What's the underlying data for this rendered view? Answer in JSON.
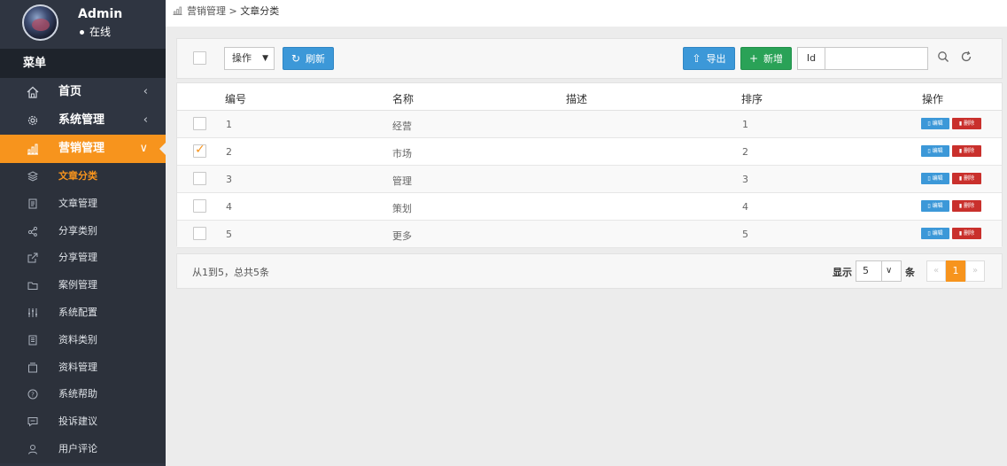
{
  "user": {
    "name": "Admin",
    "status": "在线"
  },
  "menu_header": "菜单",
  "nav": [
    {
      "label": "首页",
      "chevron": "‹"
    },
    {
      "label": "系统管理",
      "chevron": "‹"
    },
    {
      "label": "营销管理",
      "chevron": "∨"
    }
  ],
  "sub_nav": [
    {
      "label": "文章分类"
    },
    {
      "label": "文章管理"
    },
    {
      "label": "分享类别"
    },
    {
      "label": "分享管理"
    },
    {
      "label": "案例管理"
    },
    {
      "label": "系统配置"
    },
    {
      "label": "资料类别"
    },
    {
      "label": "资料管理"
    },
    {
      "label": "系统帮助"
    },
    {
      "label": "投诉建议"
    },
    {
      "label": "用户评论"
    }
  ],
  "breadcrumb": {
    "parent": "营销管理",
    "separator": ">",
    "current": "文章分类"
  },
  "toolbar": {
    "action_select": "操作",
    "refresh": "刷新",
    "export": "导出",
    "add": "新增",
    "search_label": "Id",
    "search_value": ""
  },
  "table": {
    "headers": {
      "id": "编号",
      "name": "名称",
      "desc": "描述",
      "sort": "排序",
      "ops": "操作"
    },
    "edit_label": "编辑",
    "delete_label": "删除",
    "rows": [
      {
        "id": "1",
        "name": "经营",
        "desc": "",
        "sort": "1",
        "checked": false
      },
      {
        "id": "2",
        "name": "市场",
        "desc": "",
        "sort": "2",
        "checked": true
      },
      {
        "id": "3",
        "name": "管理",
        "desc": "",
        "sort": "3",
        "checked": false
      },
      {
        "id": "4",
        "name": "策划",
        "desc": "",
        "sort": "4",
        "checked": false
      },
      {
        "id": "5",
        "name": "更多",
        "desc": "",
        "sort": "5",
        "checked": false
      }
    ]
  },
  "footer": {
    "info": "从1到5，总共5条",
    "show_label": "显示",
    "page_size": "5",
    "unit_label": "条",
    "prev": "«",
    "current_page": "1",
    "next": "»"
  },
  "colors": {
    "accent": "#f7941d",
    "primary": "#3c98d8",
    "success": "#2aa257",
    "danger": "#c9302c",
    "sidebar": "#2f3541"
  }
}
